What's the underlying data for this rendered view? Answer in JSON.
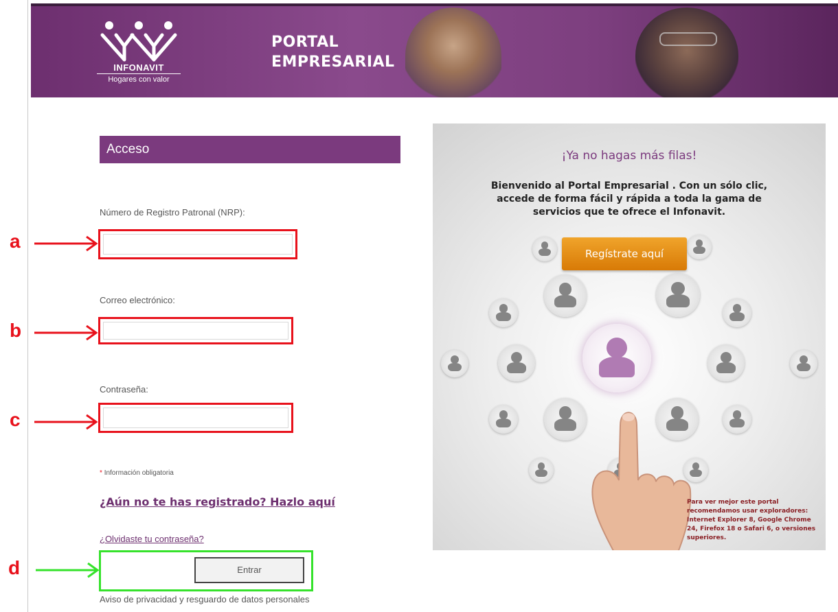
{
  "header": {
    "logo_name": "INFONAVIT",
    "logo_tagline": "Hogares con valor",
    "portal_title_line1": "PORTAL",
    "portal_title_line2": "EMPRESARIAL",
    "brand_color": "#7b3a7e"
  },
  "access": {
    "title": "Acceso",
    "nrp_label": "Número de Registro Patronal (NRP):",
    "email_label": "Correo electrónico:",
    "password_label": "Contraseña:",
    "nrp_value": "",
    "email_value": "",
    "password_value": "",
    "required_asterisk": "*",
    "required_note": "Información obligatoria",
    "register_link": "¿Aún no te has registrado? Hazlo aquí",
    "forgot_link": "¿Olvidaste tu contraseña?",
    "enter_button": "Entrar",
    "privacy_link": "Aviso de privacidad y resguardo de datos personales"
  },
  "annotations": {
    "a": "a",
    "b": "b",
    "c": "c",
    "d": "d",
    "red_color": "#e8111b",
    "green_color": "#35e22b"
  },
  "promo": {
    "title": "¡Ya no hagas más filas!",
    "text": "Bienvenido al Portal Empresarial . Con un sólo clic, accede de forma fácil y rápida  a toda la gama de servicios que te ofrece el Infonavit.",
    "register_button": "Regístrate aquí",
    "browser_note": "Para ver mejor este portal recomendamos usar exploradores: Internet Explorer 8, Google Chrome 24, Firefox 18 o Safari 6, o versiones superiores.",
    "button_color": "#e68a12"
  }
}
